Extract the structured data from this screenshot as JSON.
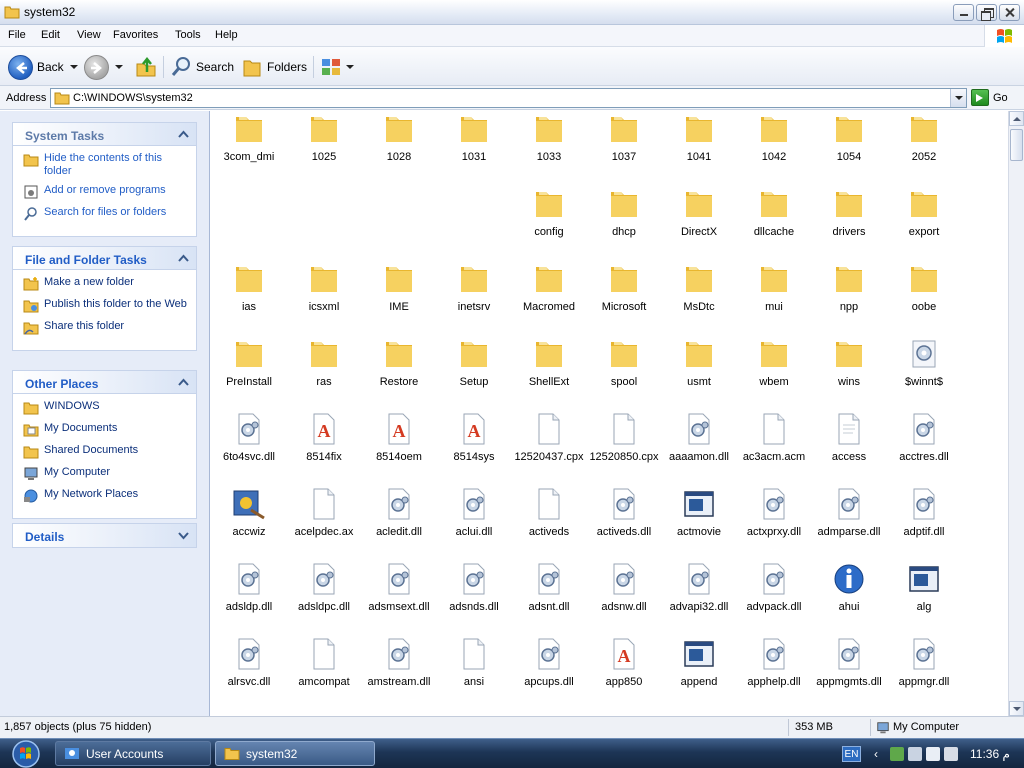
{
  "window": {
    "title": "system32"
  },
  "menu": [
    "File",
    "Edit",
    "View",
    "Favorites",
    "Tools",
    "Help"
  ],
  "toolbar": {
    "back": "Back",
    "search": "Search",
    "folders": "Folders"
  },
  "address": {
    "label": "Address",
    "path": "C:\\WINDOWS\\system32",
    "go": "Go"
  },
  "panels": {
    "system_tasks": {
      "title": "System Tasks",
      "items": [
        "Hide the contents of this folder",
        "Add or remove programs",
        "Search for files or folders"
      ]
    },
    "file_tasks": {
      "title": "File and Folder Tasks",
      "items": [
        "Make a new folder",
        "Publish this folder to the Web",
        "Share this folder"
      ]
    },
    "other_places": {
      "title": "Other Places",
      "items": [
        "WINDOWS",
        "My Documents",
        "Shared Documents",
        "My Computer",
        "My Network Places"
      ]
    },
    "details": {
      "title": "Details"
    }
  },
  "files": [
    [
      "3com_dmi",
      "folder"
    ],
    [
      "1025",
      "folder"
    ],
    [
      "1028",
      "folder"
    ],
    [
      "1031",
      "folder"
    ],
    [
      "1033",
      "folder"
    ],
    [
      "1037",
      "folder"
    ],
    [
      "1041",
      "folder"
    ],
    [
      "1042",
      "folder"
    ],
    [
      "1054",
      "folder"
    ],
    [
      "2052",
      "folder"
    ],
    [
      "",
      "blank"
    ],
    [
      "",
      "blank"
    ],
    [
      "",
      "blank"
    ],
    [
      "",
      "blank"
    ],
    [
      "config",
      "folder"
    ],
    [
      "dhcp",
      "folder"
    ],
    [
      "DirectX",
      "folder"
    ],
    [
      "dllcache",
      "folder"
    ],
    [
      "drivers",
      "folder"
    ],
    [
      "export",
      "folder"
    ],
    [
      "ias",
      "folder"
    ],
    [
      "icsxml",
      "folder"
    ],
    [
      "IME",
      "folder"
    ],
    [
      "inetsrv",
      "folder"
    ],
    [
      "Macromed",
      "folder"
    ],
    [
      "Microsoft",
      "folder"
    ],
    [
      "MsDtc",
      "folder"
    ],
    [
      "mui",
      "folder"
    ],
    [
      "npp",
      "folder"
    ],
    [
      "oobe",
      "folder"
    ],
    [
      "PreInstall",
      "folder"
    ],
    [
      "ras",
      "folder"
    ],
    [
      "Restore",
      "folder"
    ],
    [
      "Setup",
      "folder"
    ],
    [
      "ShellExt",
      "folder"
    ],
    [
      "spool",
      "folder"
    ],
    [
      "usmt",
      "folder"
    ],
    [
      "wbem",
      "folder"
    ],
    [
      "wins",
      "folder"
    ],
    [
      "$winnt$",
      "cfg"
    ],
    [
      "6to4svc.dll",
      "dll"
    ],
    [
      "8514fix",
      "font"
    ],
    [
      "8514oem",
      "font"
    ],
    [
      "8514sys",
      "font"
    ],
    [
      "12520437.cpx",
      "doc"
    ],
    [
      "12520850.cpx",
      "doc"
    ],
    [
      "aaaamon.dll",
      "dll"
    ],
    [
      "ac3acm.acm",
      "doc"
    ],
    [
      "access",
      "doc2"
    ],
    [
      "acctres.dll",
      "dll"
    ],
    [
      "accwiz",
      "wiz"
    ],
    [
      "acelpdec.ax",
      "doc"
    ],
    [
      "acledit.dll",
      "dll"
    ],
    [
      "aclui.dll",
      "dll"
    ],
    [
      "activeds",
      "doc"
    ],
    [
      "activeds.dll",
      "dll"
    ],
    [
      "actmovie",
      "app"
    ],
    [
      "actxprxy.dll",
      "dll"
    ],
    [
      "admparse.dll",
      "dll"
    ],
    [
      "adptif.dll",
      "dll"
    ],
    [
      "adsldp.dll",
      "dll"
    ],
    [
      "adsldpc.dll",
      "dll"
    ],
    [
      "adsmsext.dll",
      "dll"
    ],
    [
      "adsnds.dll",
      "dll"
    ],
    [
      "adsnt.dll",
      "dll"
    ],
    [
      "adsnw.dll",
      "dll"
    ],
    [
      "advapi32.dll",
      "dll"
    ],
    [
      "advpack.dll",
      "dll"
    ],
    [
      "ahui",
      "info"
    ],
    [
      "alg",
      "app"
    ],
    [
      "alrsvc.dll",
      "dll"
    ],
    [
      "amcompat",
      "doc"
    ],
    [
      "amstream.dll",
      "dll"
    ],
    [
      "ansi",
      "doc"
    ],
    [
      "apcups.dll",
      "dll"
    ],
    [
      "app850",
      "font"
    ],
    [
      "append",
      "app"
    ],
    [
      "apphelp.dll",
      "dll"
    ],
    [
      "appmgmts.dll",
      "dll"
    ],
    [
      "appmgr.dll",
      "dll"
    ]
  ],
  "status": {
    "objects": "1,857 objects (plus 75 hidden)",
    "size": "353 MB",
    "location": "My Computer"
  },
  "taskbar": {
    "items": [
      "User Accounts",
      "system32"
    ],
    "lang": "EN",
    "clock": "11:36 م"
  }
}
